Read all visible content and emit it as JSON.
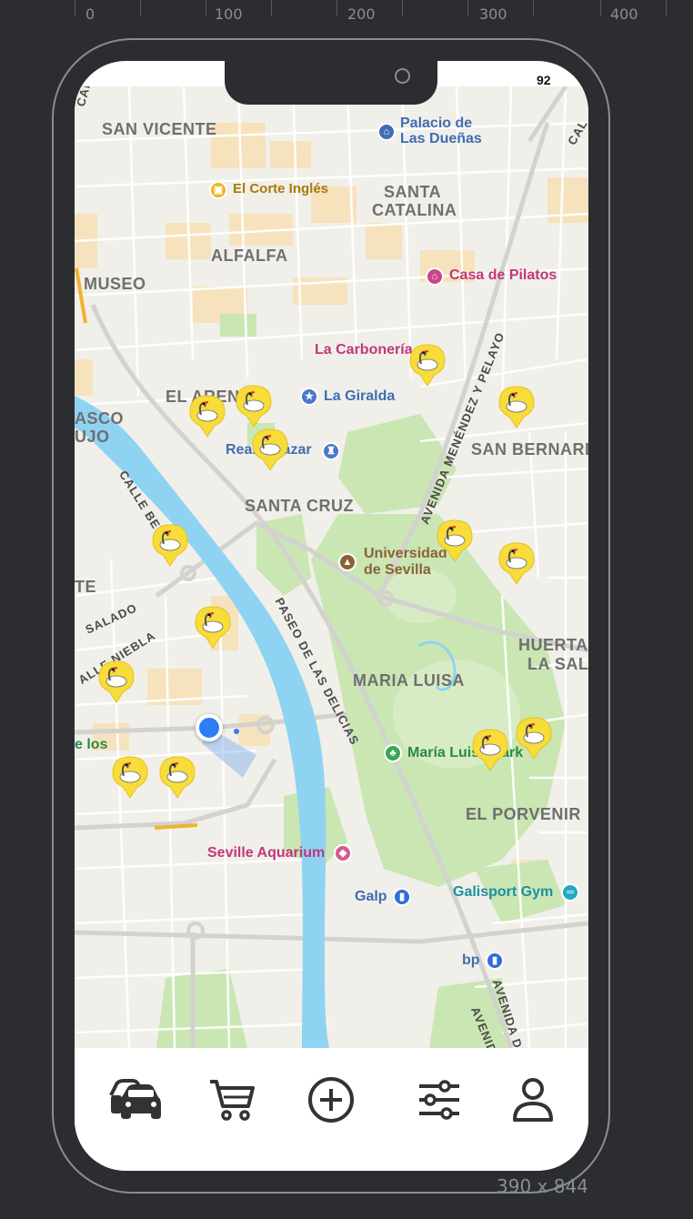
{
  "ruler": [
    "0",
    "100",
    "200",
    "300",
    "400"
  ],
  "status": {
    "battery": "92"
  },
  "map": {
    "districts": [
      "SAN VICENTE",
      "SANTA",
      "CATALINA",
      "ALFALFA",
      "MUSEO",
      "EL ARENAL",
      "ASCO",
      "UJO",
      "SAN BERNARDO",
      "SANTA CRUZ",
      "TE",
      "MARIA LUISA",
      "HUERTAS",
      "LA SALU",
      "EL PORVENIR"
    ],
    "streets": [
      "CALLE",
      "CALLE BETIS",
      "SALADO",
      "ALLE NIEBLA",
      "AVENIDA MENÉNDEZ Y PELAYO",
      "PASEO DE LAS DELICIAS",
      "AVENIDA DE",
      "AVENIDA",
      "CAL"
    ],
    "pois": {
      "palacio": "Palacio de\nLas Dueñas",
      "corte_ingles": "El Corte Inglés",
      "casa_pilatos": "Casa de Pilatos",
      "carboneria": "La Carbonería",
      "giralda": "La Giralda",
      "alcazar": "Real Alcázar",
      "universidad_1": "Universidad",
      "universidad_2": "de Sevilla",
      "maria_luisa_park": "María Luisa Park",
      "aquarium": "Seville Aquarium",
      "galp": "Galp",
      "galisport": "Galisport Gym",
      "bp": "bp",
      "de_los": "e los"
    },
    "marker_count": 14
  },
  "tabbar": {
    "items": [
      {
        "icon": "car-icon"
      },
      {
        "icon": "cart-icon"
      },
      {
        "icon": "add-circle-icon"
      },
      {
        "icon": "sliders-icon"
      },
      {
        "icon": "user-icon"
      }
    ]
  },
  "device": {
    "dimensions": "390 x 844"
  },
  "colors": {
    "accent": "#2e7cf6",
    "river": "#8fd3f3",
    "park": "#c9e6b3",
    "marker": "#f7dc3a"
  }
}
